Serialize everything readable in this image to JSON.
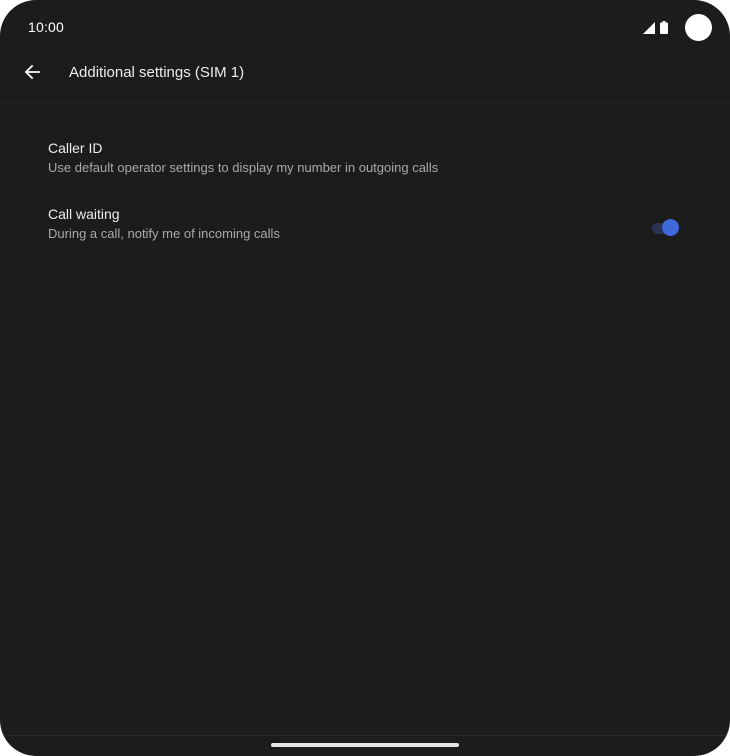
{
  "status_bar": {
    "time": "10:00",
    "signal_icon": "signal-icon",
    "battery_icon": "battery-icon"
  },
  "app_bar": {
    "back_icon": "arrow-back-icon",
    "title": "Additional settings (SIM 1)"
  },
  "settings": [
    {
      "title": "Caller ID",
      "summary": "Use default operator settings to display my number in outgoing calls"
    },
    {
      "title": "Call waiting",
      "summary": "During a call, notify me of incoming calls",
      "toggle_on": true
    }
  ],
  "colors": {
    "background": "#1c1c1d",
    "accent": "#3f68d8",
    "text_primary": "#ededed",
    "text_secondary": "#a9a9ab"
  }
}
